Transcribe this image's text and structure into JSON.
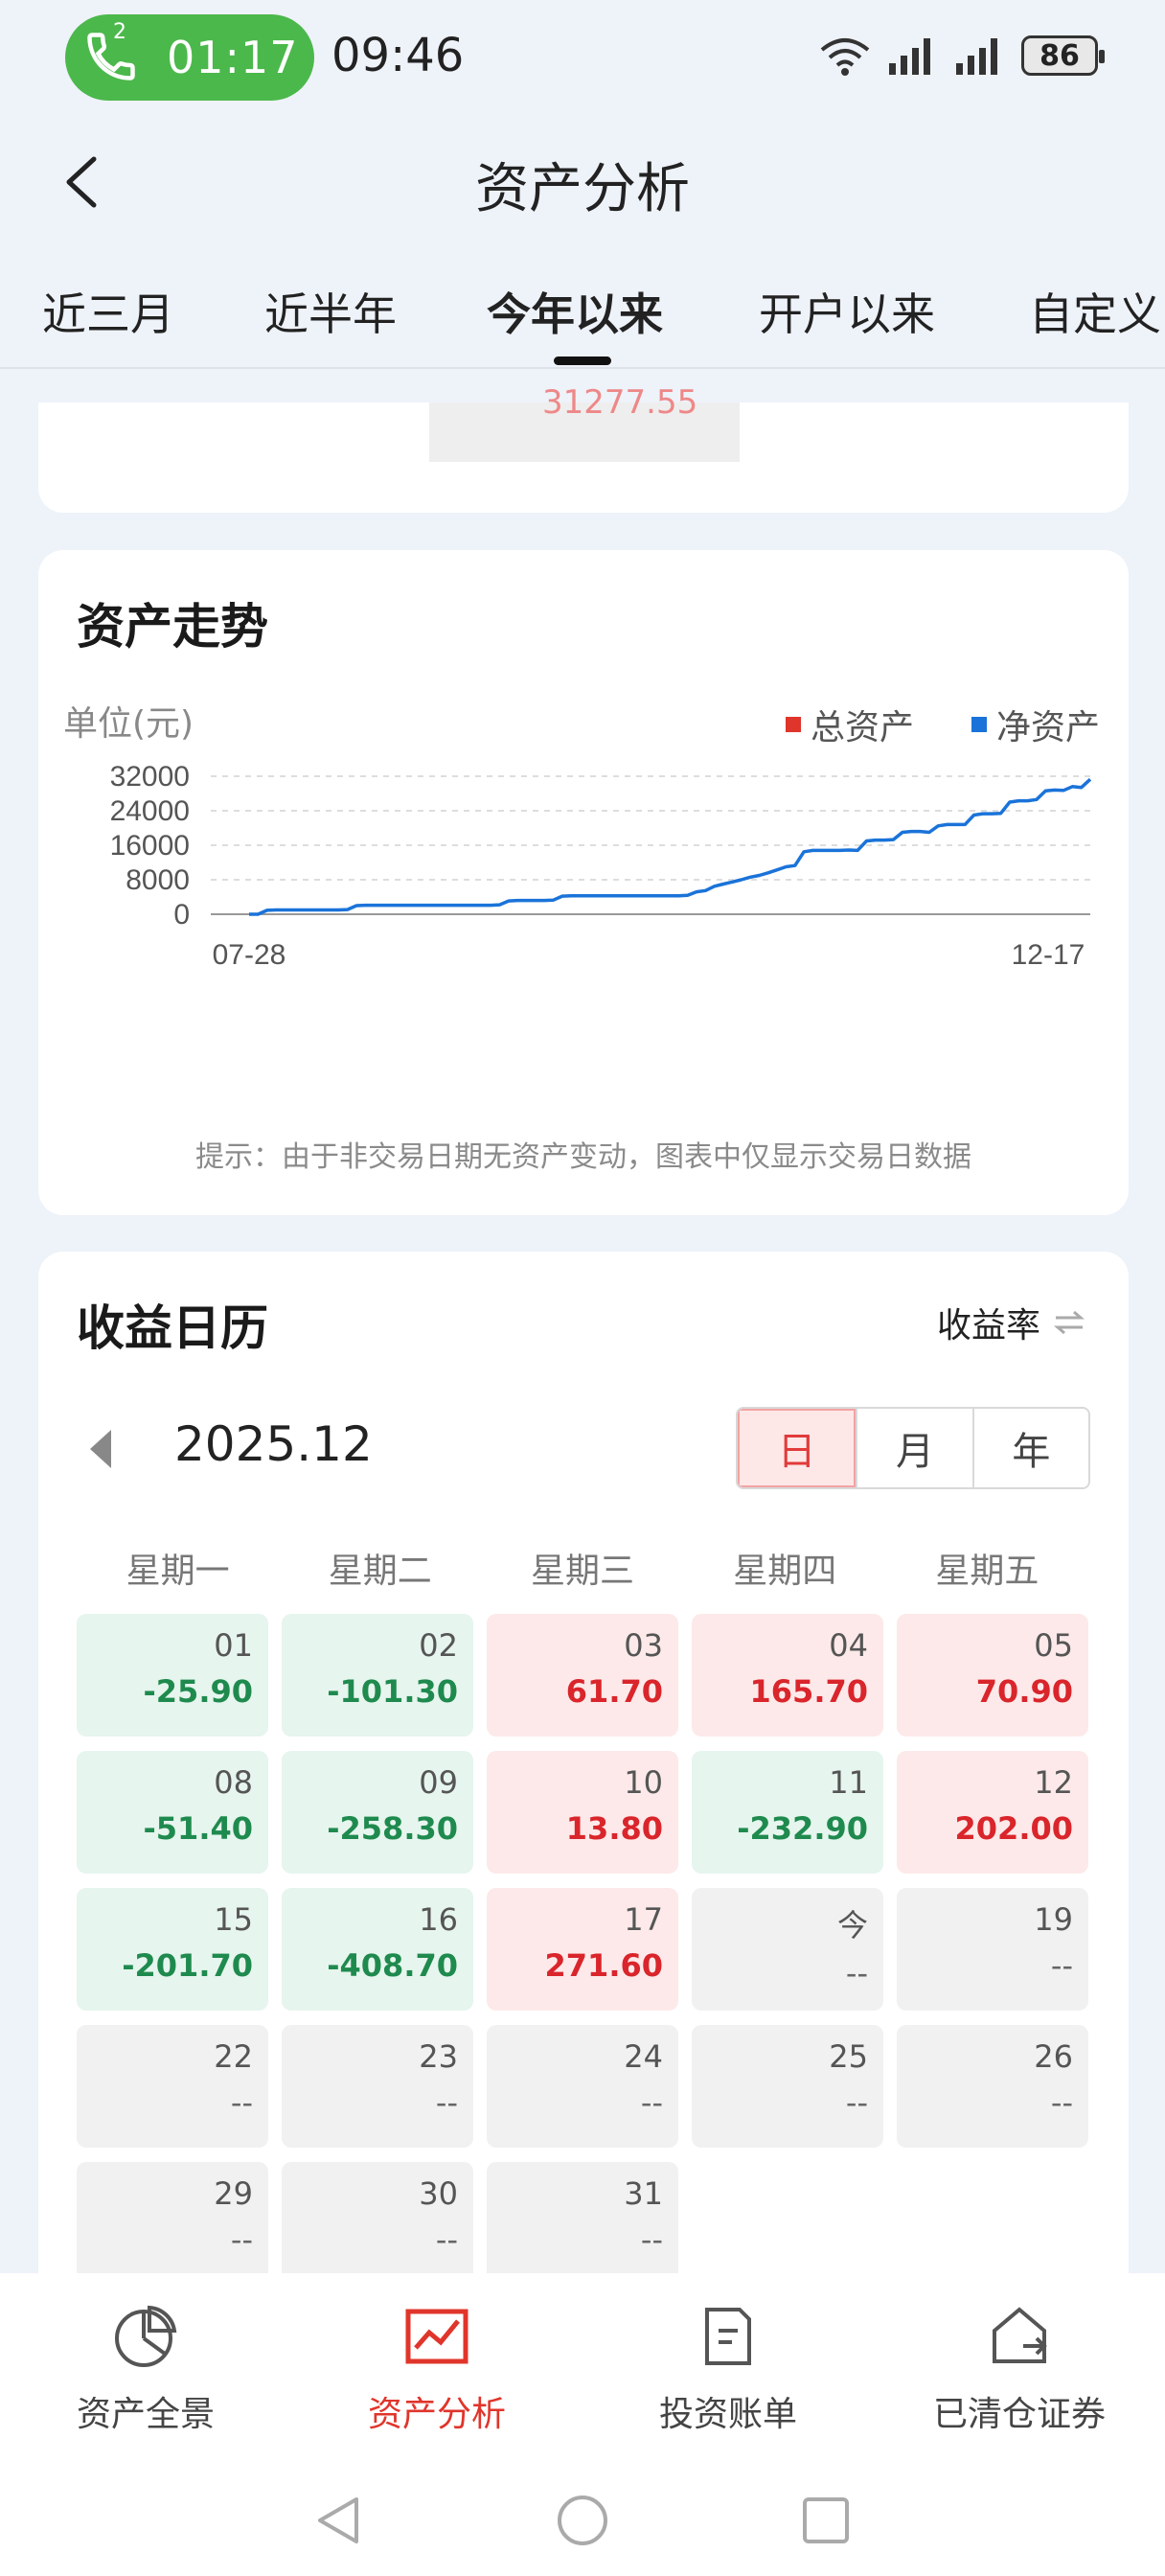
{
  "status_bar": {
    "call_badge_count": "2",
    "call_timer": "01:17",
    "clock": "09:46",
    "battery": "86"
  },
  "header": {
    "title": "资产分析"
  },
  "tabs": [
    {
      "label": "近三月",
      "active": false
    },
    {
      "label": "近半年",
      "active": false
    },
    {
      "label": "今年以来",
      "active": true
    },
    {
      "label": "开户以来",
      "active": false
    },
    {
      "label": "自定义",
      "active": false
    }
  ],
  "top_card": {
    "partial_value": "31277.55"
  },
  "trend": {
    "title": "资产走势",
    "unit": "单位(元)",
    "legend": [
      {
        "label": "总资产",
        "color": "#e0352b"
      },
      {
        "label": "净资产",
        "color": "#1a73d9"
      }
    ],
    "hint": "提示：由于非交易日期无资产变动，图表中仅显示交易日数据"
  },
  "chart_data": {
    "type": "line",
    "title": "资产走势",
    "ylabel": "单位(元)",
    "y_ticks": [
      0,
      8000,
      16000,
      24000,
      32000
    ],
    "ylim": [
      0,
      32000
    ],
    "x_labels": [
      "07-28",
      "12-17"
    ],
    "grid": true,
    "legend_position": "top-right",
    "series": [
      {
        "name": "净资产",
        "color": "#1a73d9",
        "values": [
          0,
          0,
          900,
          1000,
          1000,
          1000,
          1000,
          1000,
          1000,
          1000,
          1000,
          1100,
          2000,
          2100,
          2100,
          2100,
          2100,
          2100,
          2100,
          2100,
          2100,
          2100,
          2100,
          2100,
          2100,
          2100,
          2100,
          2100,
          2200,
          3100,
          3200,
          3200,
          3200,
          3200,
          3300,
          4200,
          4300,
          4300,
          4300,
          4300,
          4300,
          4300,
          4300,
          4300,
          4300,
          4300,
          4300,
          4300,
          4300,
          4400,
          5200,
          5500,
          6500,
          7000,
          7500,
          8000,
          8600,
          9000,
          9600,
          10300,
          11000,
          11300,
          14500,
          14800,
          14800,
          14800,
          14800,
          14900,
          14800,
          17000,
          17200,
          17200,
          17300,
          19000,
          19200,
          19200,
          19000,
          20500,
          20800,
          20800,
          20800,
          23000,
          23300,
          23300,
          23400,
          26000,
          26300,
          26300,
          26600,
          28600,
          28800,
          28700,
          29600,
          29400,
          31300
        ]
      }
    ]
  },
  "calendar": {
    "title": "收益日历",
    "toggle_label": "收益率",
    "toggle_icon": "swap-arrows-icon",
    "month": "2025.12",
    "segments": [
      {
        "label": "日",
        "active": true
      },
      {
        "label": "月",
        "active": false
      },
      {
        "label": "年",
        "active": false
      }
    ],
    "weekdays": [
      "星期一",
      "星期二",
      "星期三",
      "星期四",
      "星期五"
    ],
    "days": [
      {
        "day": "01",
        "value": "-25.90",
        "kind": "neg"
      },
      {
        "day": "02",
        "value": "-101.30",
        "kind": "neg"
      },
      {
        "day": "03",
        "value": "61.70",
        "kind": "pos"
      },
      {
        "day": "04",
        "value": "165.70",
        "kind": "pos"
      },
      {
        "day": "05",
        "value": "70.90",
        "kind": "pos"
      },
      {
        "day": "08",
        "value": "-51.40",
        "kind": "neg"
      },
      {
        "day": "09",
        "value": "-258.30",
        "kind": "neg"
      },
      {
        "day": "10",
        "value": "13.80",
        "kind": "pos"
      },
      {
        "day": "11",
        "value": "-232.90",
        "kind": "neg"
      },
      {
        "day": "12",
        "value": "202.00",
        "kind": "pos"
      },
      {
        "day": "15",
        "value": "-201.70",
        "kind": "neg"
      },
      {
        "day": "16",
        "value": "-408.70",
        "kind": "neg"
      },
      {
        "day": "17",
        "value": "271.60",
        "kind": "pos"
      },
      {
        "day": "今",
        "value": "--",
        "kind": "none"
      },
      {
        "day": "19",
        "value": "--",
        "kind": "none"
      },
      {
        "day": "22",
        "value": "--",
        "kind": "none"
      },
      {
        "day": "23",
        "value": "--",
        "kind": "none"
      },
      {
        "day": "24",
        "value": "--",
        "kind": "none"
      },
      {
        "day": "25",
        "value": "--",
        "kind": "none"
      },
      {
        "day": "26",
        "value": "--",
        "kind": "none"
      },
      {
        "day": "29",
        "value": "--",
        "kind": "none"
      },
      {
        "day": "30",
        "value": "--",
        "kind": "none"
      },
      {
        "day": "31",
        "value": "--",
        "kind": "none"
      }
    ]
  },
  "bottom_nav": [
    {
      "label": "资产全景",
      "icon": "pie-chart-icon",
      "active": false
    },
    {
      "label": "资产分析",
      "icon": "line-chart-icon",
      "active": true
    },
    {
      "label": "投资账单",
      "icon": "document-icon",
      "active": false
    },
    {
      "label": "已清仓证券",
      "icon": "house-exit-icon",
      "active": false
    }
  ]
}
